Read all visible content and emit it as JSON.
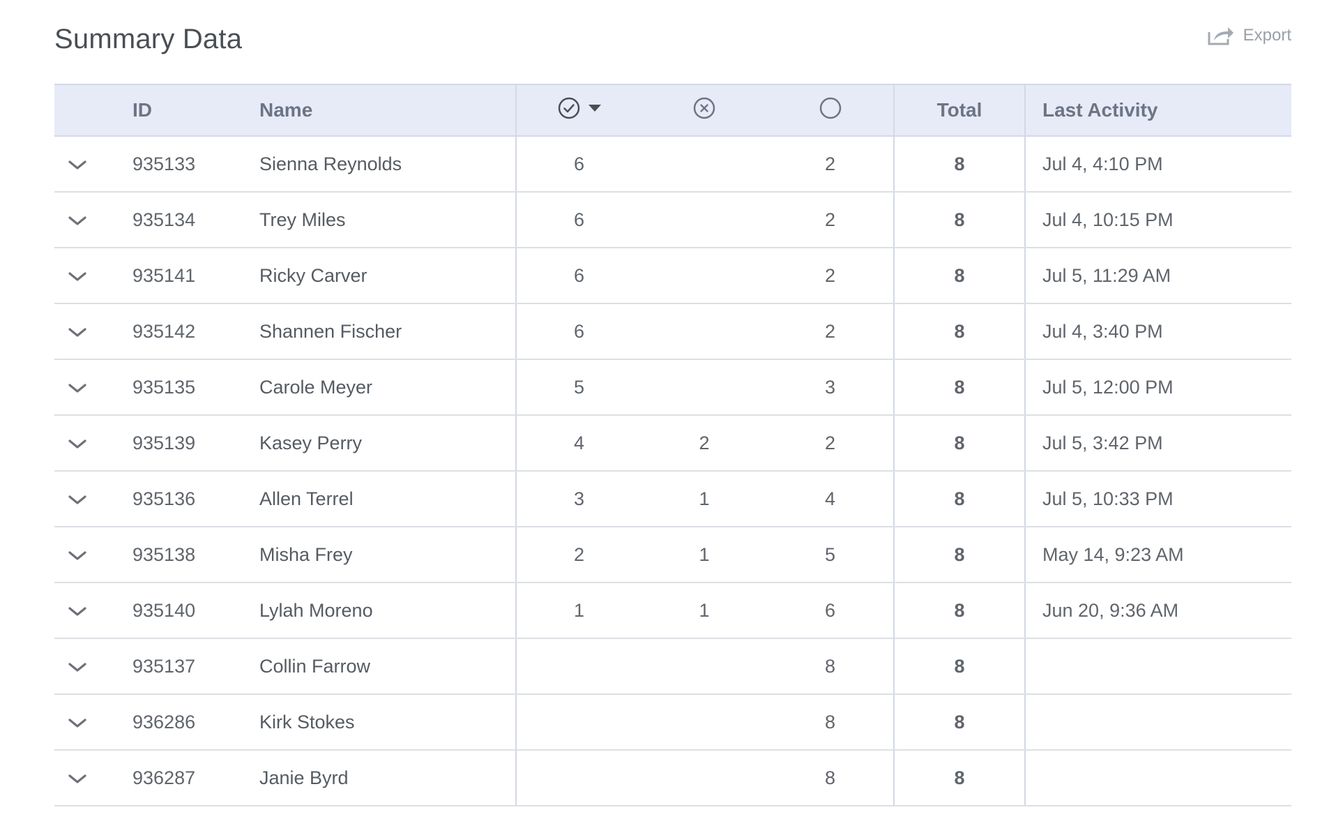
{
  "page": {
    "title": "Summary Data",
    "export_label": "Export"
  },
  "table": {
    "headers": {
      "id": "ID",
      "name": "Name",
      "completed_icon": "check-circle-icon",
      "failed_icon": "x-circle-icon",
      "open_icon": "empty-circle-icon",
      "total": "Total",
      "last_activity": "Last Activity"
    },
    "sort": {
      "column": "completed",
      "direction": "descending"
    },
    "rows": [
      {
        "id": "935133",
        "name": "Sienna Reynolds",
        "completed": "6",
        "failed": "",
        "open": "2",
        "total": "8",
        "last_activity": "Jul 4, 4:10 PM"
      },
      {
        "id": "935134",
        "name": "Trey Miles",
        "completed": "6",
        "failed": "",
        "open": "2",
        "total": "8",
        "last_activity": "Jul 4, 10:15 PM"
      },
      {
        "id": "935141",
        "name": "Ricky Carver",
        "completed": "6",
        "failed": "",
        "open": "2",
        "total": "8",
        "last_activity": "Jul 5, 11:29 AM"
      },
      {
        "id": "935142",
        "name": "Shannen Fischer",
        "completed": "6",
        "failed": "",
        "open": "2",
        "total": "8",
        "last_activity": "Jul 4, 3:40 PM"
      },
      {
        "id": "935135",
        "name": "Carole Meyer",
        "completed": "5",
        "failed": "",
        "open": "3",
        "total": "8",
        "last_activity": "Jul 5, 12:00 PM"
      },
      {
        "id": "935139",
        "name": "Kasey Perry",
        "completed": "4",
        "failed": "2",
        "open": "2",
        "total": "8",
        "last_activity": "Jul 5, 3:42 PM"
      },
      {
        "id": "935136",
        "name": "Allen Terrel",
        "completed": "3",
        "failed": "1",
        "open": "4",
        "total": "8",
        "last_activity": "Jul 5, 10:33 PM"
      },
      {
        "id": "935138",
        "name": "Misha Frey",
        "completed": "2",
        "failed": "1",
        "open": "5",
        "total": "8",
        "last_activity": "May 14, 9:23 AM"
      },
      {
        "id": "935140",
        "name": "Lylah Moreno",
        "completed": "1",
        "failed": "1",
        "open": "6",
        "total": "8",
        "last_activity": "Jun 20, 9:36 AM"
      },
      {
        "id": "935137",
        "name": "Collin Farrow",
        "completed": "",
        "failed": "",
        "open": "8",
        "total": "8",
        "last_activity": ""
      },
      {
        "id": "936286",
        "name": "Kirk Stokes",
        "completed": "",
        "failed": "",
        "open": "8",
        "total": "8",
        "last_activity": ""
      },
      {
        "id": "936287",
        "name": "Janie Byrd",
        "completed": "",
        "failed": "",
        "open": "8",
        "total": "8",
        "last_activity": ""
      }
    ]
  },
  "colors": {
    "header_bg": "#e7ebf7",
    "header_text": "#6c7485",
    "row_border": "#dcdfe4",
    "muted": "#9aa0a8"
  }
}
